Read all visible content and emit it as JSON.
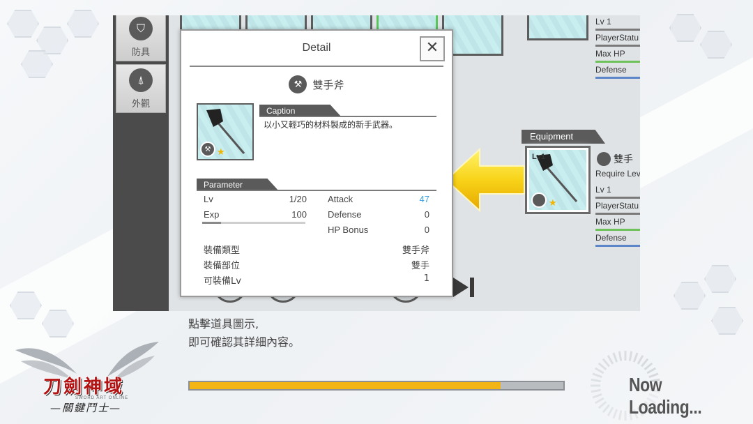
{
  "sidebar": {
    "tabs": [
      {
        "label": "防具",
        "icon": "shield-icon"
      },
      {
        "label": "外觀",
        "icon": "coat-icon"
      }
    ]
  },
  "right_panel": {
    "top_stats": [
      "Lv  1",
      "PlayerStatu",
      "Max HP",
      "Defense"
    ],
    "equipment_label": "Equipment",
    "equipped_name": "雙手",
    "equipped_card_lv": "Lv1",
    "equipped_stats": [
      "Require Leve",
      "Lv  1",
      "PlayerStatu",
      "Max HP",
      "Defense"
    ]
  },
  "dialog": {
    "title": "Detail",
    "close_label": "✕",
    "item_name": "雙手斧",
    "caption_tag": "Caption",
    "caption_text": "以小又輕巧的材料製成的新手武器。",
    "parameter_tag": "Parameter",
    "params_left": [
      {
        "label": "Lv",
        "value": "1/20"
      },
      {
        "label": "Exp",
        "value": "100"
      }
    ],
    "params_right": [
      {
        "label": "Attack",
        "value": "47"
      },
      {
        "label": "Defense",
        "value": "0"
      },
      {
        "label": "HP Bonus",
        "value": "0"
      }
    ],
    "info_rows": [
      {
        "label": "裝備類型",
        "value": "雙手斧"
      },
      {
        "label": "裝備部位",
        "value": "雙手"
      },
      {
        "label": "可裝備Lv",
        "value": "1"
      }
    ],
    "attack_color": "#3aa0e6"
  },
  "hint": {
    "line1": "點擊道具圖示,",
    "line2": "即可確認其詳細內容。"
  },
  "loading": {
    "progress": 0.833,
    "text": "Now Loading...",
    "bar_color": "#f3b416"
  },
  "logo": {
    "title": "刀劍神域",
    "subtitle": "SWORD ART ONLINE",
    "tagline": "—關鍵鬥士—"
  }
}
